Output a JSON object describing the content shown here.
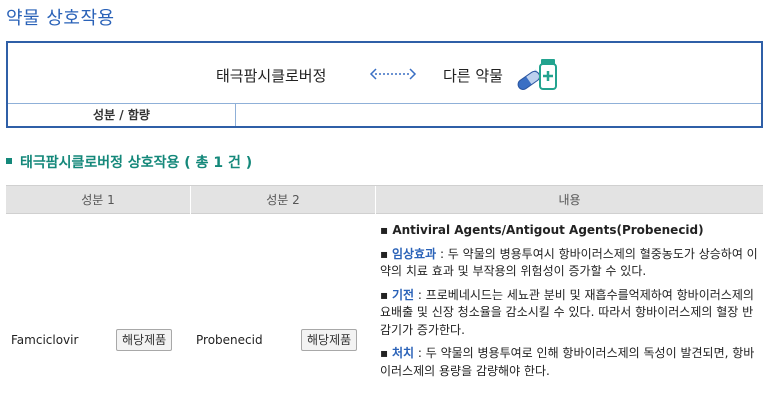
{
  "page": {
    "title": "약물 상호작용"
  },
  "summary": {
    "drug_a": "태극팜시클로버정",
    "drug_b": "다른 약물",
    "component_label": "성분 / 함량",
    "component_value": ""
  },
  "section": {
    "title": "태극팜시클로버정 상호작용 ( 총 1 건 )"
  },
  "table": {
    "headers": [
      "성분 1",
      "성분 2",
      "내용"
    ],
    "rows": [
      {
        "ingredient1": "Famciclovir",
        "product_button1": "해당제품",
        "ingredient2": "Probenecid",
        "product_button2": "해당제품",
        "agent": "Antiviral Agents/Antigout Agents(Probenecid)",
        "items": [
          {
            "label": "임상효과",
            "text": "두 약물의 병용투여시 항바이러스제의 혈중농도가 상승하여 이 약의 치료 효과 및 부작용의 위험성이 증가할 수 있다."
          },
          {
            "label": "기전",
            "text": "프로베네시드는 세뇨관 분비 및 재흡수를억제하여 항바이러스제의 요배출 및 신장 청소율을 감소시킬 수 있다. 따라서 항바이러스제의 혈장 반감기가 증가한다."
          },
          {
            "label": "처치",
            "text": "두 약물의 병용투여로 인해 항바이러스제의 독성이 발견되면, 항바이러스제의 용량을 감량해야 한다."
          }
        ]
      }
    ]
  },
  "colors": {
    "title_blue": "#2a62b8",
    "border_blue": "#2f5fa7",
    "section_green": "#14887a",
    "header_gray": "#e3e3e3"
  },
  "icons": [
    "double-arrow-icon",
    "pill-bottle-icon"
  ]
}
